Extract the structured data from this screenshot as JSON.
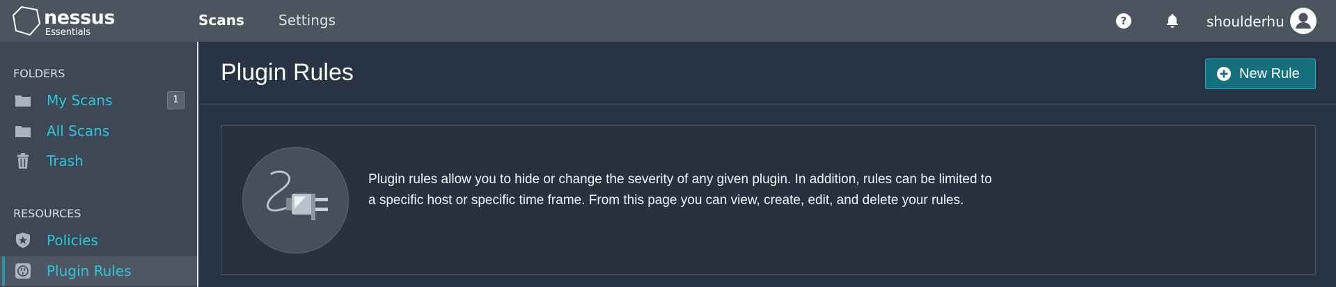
{
  "header": {
    "brand": "nessus",
    "edition": "Essentials",
    "nav": {
      "scans": "Scans",
      "settings": "Settings"
    },
    "username": "shoulderhu",
    "icons": {
      "help": "help-icon",
      "notifications": "bell-icon",
      "user": "user-avatar-icon"
    }
  },
  "sidebar": {
    "folders_label": "FOLDERS",
    "folders": [
      {
        "label": "My Scans",
        "icon": "folder-icon",
        "badge": "1"
      },
      {
        "label": "All Scans",
        "icon": "folder-icon"
      },
      {
        "label": "Trash",
        "icon": "trash-icon"
      }
    ],
    "resources_label": "RESOURCES",
    "resources": [
      {
        "label": "Policies",
        "icon": "shield-star-icon"
      },
      {
        "label": "Plugin Rules",
        "icon": "plug-icon",
        "active": true
      }
    ]
  },
  "main": {
    "title": "Plugin Rules",
    "new_rule_label": "New Rule",
    "description": "Plugin rules allow you to hide or change the severity of any given plugin. In addition, rules can be limited to a specific host or specific time frame. From this page you can view, create, edit, and delete your rules."
  },
  "colors": {
    "topbar": "#4b545f",
    "sidebar": "#3e4854",
    "main_bg": "#283444",
    "link": "#2cc5dc",
    "button": "#156f7c"
  }
}
